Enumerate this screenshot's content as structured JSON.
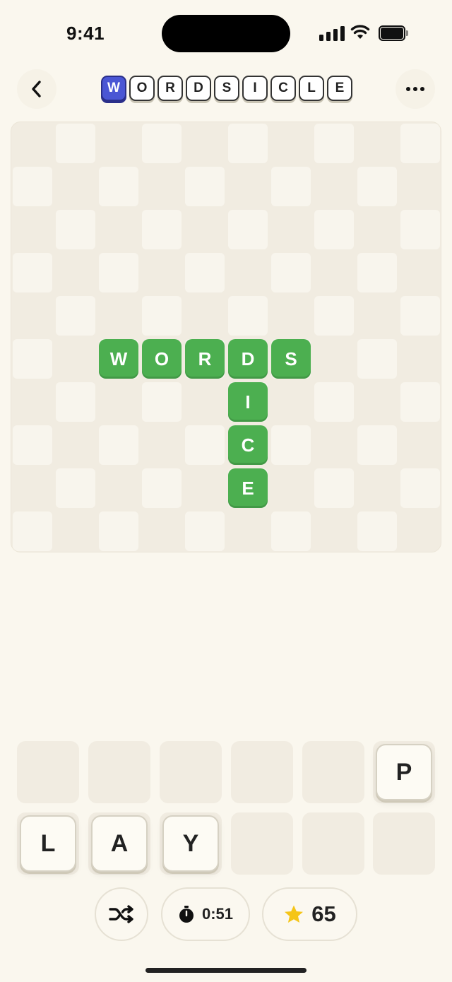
{
  "status_bar": {
    "time": "9:41"
  },
  "header": {
    "back_icon": "chevron-left-icon",
    "more_icon": "more-horizontal-icon",
    "logo_letters": [
      "W",
      "O",
      "R",
      "D",
      "S",
      "I",
      "C",
      "L",
      "E"
    ],
    "logo_accent": "#4a56d4"
  },
  "board": {
    "placed_color": "#4caf50",
    "horizontal_word": [
      "W",
      "O",
      "R",
      "D",
      "S"
    ],
    "vertical_word_rest": [
      "I",
      "C",
      "E"
    ]
  },
  "rack": {
    "top_row_tile": "P",
    "bottom_row_tiles": [
      "L",
      "A",
      "Y"
    ]
  },
  "controls": {
    "shuffle_icon": "shuffle-icon",
    "timer_icon": "stopwatch-icon",
    "timer_value": "0:51",
    "score_icon": "star-icon",
    "score_value": "65",
    "star_color": "#f5c518"
  }
}
